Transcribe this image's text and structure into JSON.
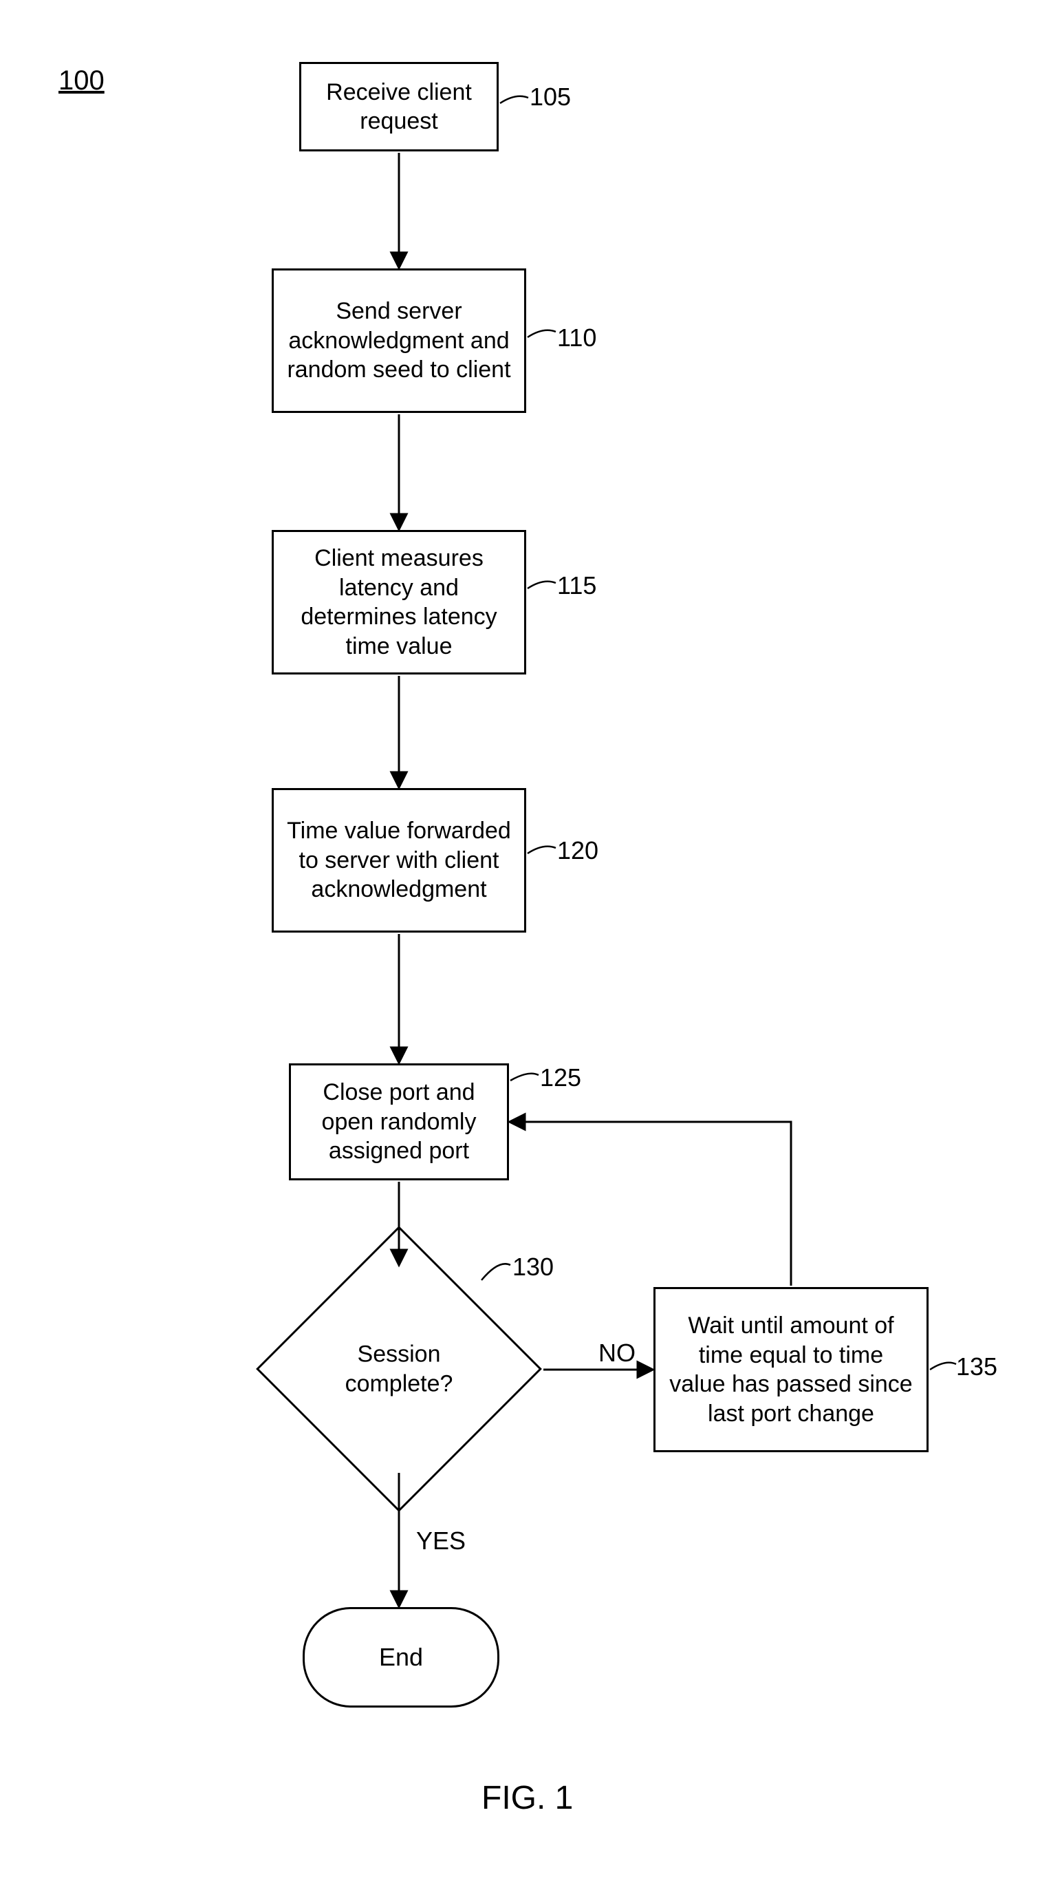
{
  "figure": {
    "ref": "100",
    "caption": "FIG. 1"
  },
  "nodes": {
    "n105": {
      "text": "Receive client request",
      "tag": "105"
    },
    "n110": {
      "text": "Send server acknowledgment and random seed to client",
      "tag": "110"
    },
    "n115": {
      "text": "Client measures latency and determines latency time value",
      "tag": "115"
    },
    "n120": {
      "text": "Time value forwarded to server with client acknowledgment",
      "tag": "120"
    },
    "n125": {
      "text": "Close port and open randomly assigned port",
      "tag": "125"
    },
    "n130": {
      "text": "Session complete?",
      "tag": "130"
    },
    "n135": {
      "text": "Wait until amount of time equal to time value has passed since last port change",
      "tag": "135"
    },
    "end": {
      "text": "End"
    }
  },
  "edges": {
    "yes": "YES",
    "no": "NO"
  }
}
